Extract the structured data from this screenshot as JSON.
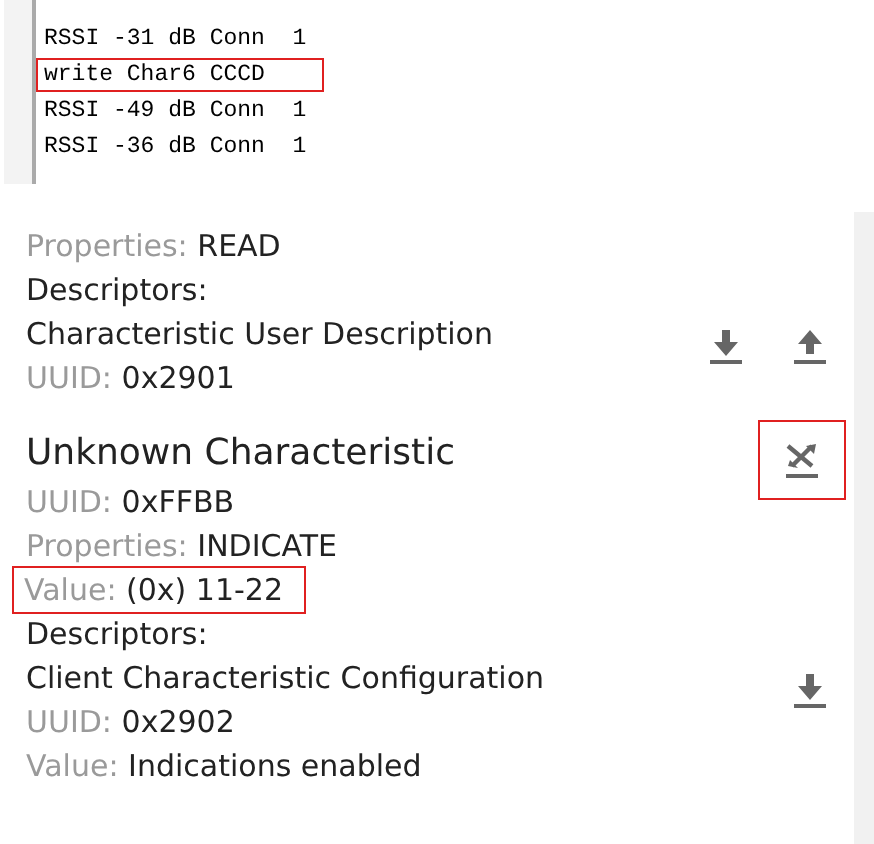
{
  "log": {
    "lines": [
      {
        "text": "RSSI -31 dB Conn  1",
        "highlighted": false
      },
      {
        "text": "write Char6 CCCD",
        "highlighted": true
      },
      {
        "text": "RSSI -49 dB Conn  1",
        "highlighted": false
      },
      {
        "text": "RSSI -36 dB Conn  1",
        "highlighted": false
      }
    ]
  },
  "characteristics": [
    {
      "kind": "partial",
      "properties": [
        {
          "label": "Properties:",
          "value": "READ",
          "highlighted": false
        }
      ],
      "descriptors_label": "Descriptors:",
      "descriptors": [
        {
          "name": "Characteristic User Description",
          "properties": [
            {
              "label": "UUID:",
              "value": "0x2901"
            }
          ],
          "actions": [
            {
              "kind": "read",
              "highlighted": false
            },
            {
              "kind": "write",
              "highlighted": false
            }
          ]
        }
      ]
    },
    {
      "kind": "full",
      "name": "Unknown Characteristic",
      "properties": [
        {
          "label": "UUID:",
          "value": "0xFFBB",
          "highlighted": false
        },
        {
          "label": "Properties:",
          "value": "INDICATE",
          "highlighted": false
        },
        {
          "label": "Value:",
          "value": "(0x) 11-22",
          "highlighted": true
        }
      ],
      "actions": [
        {
          "kind": "indicate",
          "highlighted": true
        }
      ],
      "descriptors_label": "Descriptors:",
      "descriptors": [
        {
          "name": "Client Characteristic Configuration",
          "properties": [
            {
              "label": "UUID:",
              "value": "0x2902"
            },
            {
              "label": "Value:",
              "value": "Indications enabled"
            }
          ],
          "actions": [
            {
              "kind": "read",
              "highlighted": false
            }
          ]
        }
      ]
    }
  ]
}
